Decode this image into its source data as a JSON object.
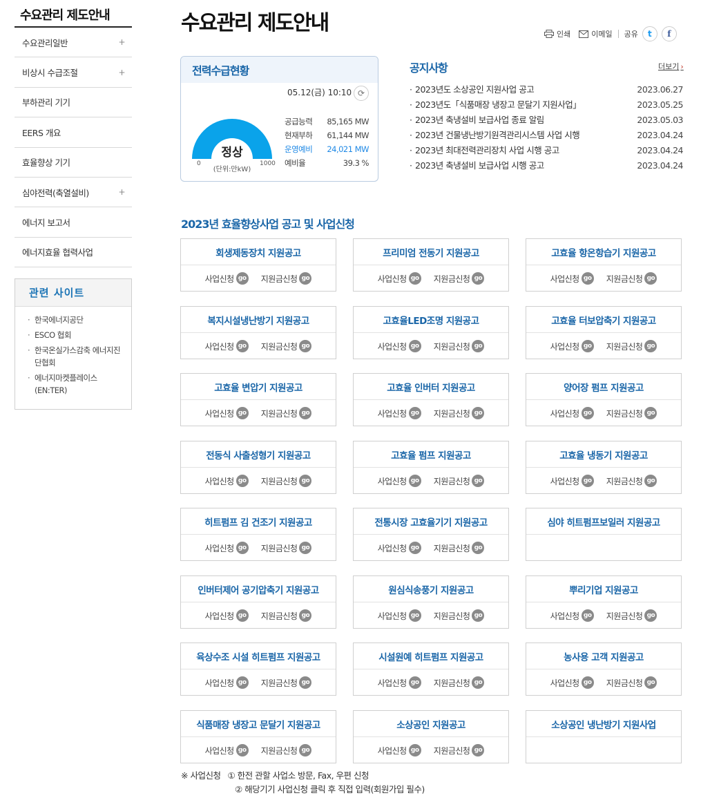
{
  "sidebar": {
    "title": "수요관리 제도안내",
    "items": [
      {
        "label": "수요관리일반",
        "plus": "+"
      },
      {
        "label": "비상시 수급조절",
        "plus": "+"
      },
      {
        "label": "부하관리 기기",
        "plus": ""
      },
      {
        "label": "EERS 개요",
        "plus": ""
      },
      {
        "label": "효율향상 기기",
        "plus": ""
      },
      {
        "label": "심야전력(축열설비)",
        "plus": "+"
      },
      {
        "label": "에너지 보고서",
        "plus": ""
      },
      {
        "label": "에너지효율 협력사업",
        "plus": ""
      }
    ],
    "related_title": "관련 사이트",
    "related": [
      "한국에너지공단",
      "ESCO 협회",
      "한국온실가스감축 에너지진단협회",
      "에너지마켓플레이스 (EN:TER)"
    ]
  },
  "header": {
    "title": "수요관리 제도안내",
    "print": "인쇄",
    "email": "이메일",
    "share": "공유",
    "twitter": "t",
    "facebook": "f"
  },
  "power": {
    "title": "전력수급현황",
    "time": "05.12(금) 10:10",
    "status": "정상",
    "unit": "(단위:만kW)",
    "min": "0",
    "max": "1000",
    "stats": [
      {
        "label": "공급능력",
        "value": "85,165 MW"
      },
      {
        "label": "현재부하",
        "value": "61,144 MW"
      },
      {
        "label": "운영예비",
        "value": "24,021 MW"
      },
      {
        "label": "예비율",
        "value": "39.3 %"
      }
    ]
  },
  "notice": {
    "title": "공지사항",
    "more": "더보기",
    "items": [
      {
        "title": "2023년도 소상공인 지원사업 공고",
        "date": "2023.06.27"
      },
      {
        "title": "2023년도「식품매장 냉장고 문달기 지원사업」",
        "date": "2023.05.25"
      },
      {
        "title": "2023년 축냉설비 보급사업 종료 알림",
        "date": "2023.05.03"
      },
      {
        "title": "2023년 건물냉난방기원격관리시스템 사업 시행",
        "date": "2023.04.24"
      },
      {
        "title": "2023년 최대전력관리장치 사업 시행 공고",
        "date": "2023.04.24"
      },
      {
        "title": "2023년 축냉설비 보급사업 시행 공고",
        "date": "2023.04.24"
      }
    ]
  },
  "programs": {
    "title": "2023년 효율향상사업 공고 및 사업신청",
    "apply_label": "사업신청",
    "subsidy_label": "지원금신청",
    "go_label": "go",
    "cards": [
      {
        "title": "회생제동장치 지원공고",
        "actions": true
      },
      {
        "title": "프리미엄 전동기 지원공고",
        "actions": true
      },
      {
        "title": "고효율 항온항습기 지원공고",
        "actions": true
      },
      {
        "title": "복지시설냉난방기 지원공고",
        "actions": true
      },
      {
        "title": "고효율LED조명 지원공고",
        "actions": true
      },
      {
        "title": "고효율 터보압축기 지원공고",
        "actions": true
      },
      {
        "title": "고효율 변압기 지원공고",
        "actions": true
      },
      {
        "title": "고효율 인버터 지원공고",
        "actions": true
      },
      {
        "title": "양어장 펌프 지원공고",
        "actions": true
      },
      {
        "title": "전동식 사출성형기 지원공고",
        "actions": true
      },
      {
        "title": "고효율 펌프 지원공고",
        "actions": true
      },
      {
        "title": "고효율 냉동기 지원공고",
        "actions": true
      },
      {
        "title": "히트펌프 김 건조기 지원공고",
        "actions": true
      },
      {
        "title": "전통시장 고효율기기 지원공고",
        "actions": true
      },
      {
        "title": "심야 히트펌프보일러 지원공고",
        "actions": false
      },
      {
        "title": "인버터제어 공기압축기 지원공고",
        "actions": true
      },
      {
        "title": "원심식송풍기 지원공고",
        "actions": true
      },
      {
        "title": "뿌리기업 지원공고",
        "actions": true
      },
      {
        "title": "육상수조 시설 히트펌프 지원공고",
        "actions": true
      },
      {
        "title": "시설원예 히트펌프 지원공고",
        "actions": true
      },
      {
        "title": "농사용 고객 지원공고",
        "actions": true
      },
      {
        "title": "식품매장 냉장고 문달기 지원공고",
        "actions": true
      },
      {
        "title": "소상공인 지원공고",
        "actions": true
      },
      {
        "title": "소상공인 냉난방기 지원사업",
        "actions": false
      }
    ]
  },
  "footnote": {
    "label": "※ 사업신청",
    "line1": "① 한전 관할 사업소 방문, Fax, 우편 신청",
    "line2": "② 해당기기 사업신청 클릭 후 직접 입력(회원가입 필수)"
  }
}
